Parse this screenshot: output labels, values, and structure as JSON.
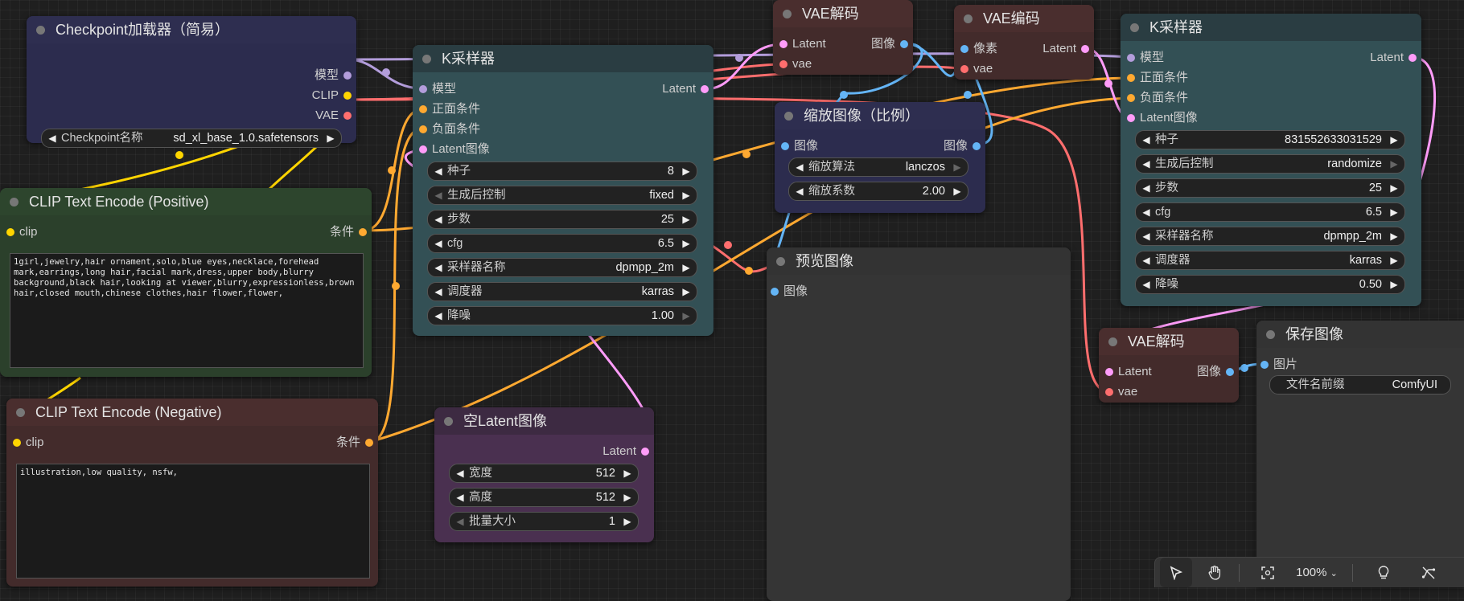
{
  "colors": {
    "model": "#b39ddb",
    "clip": "#ffd500",
    "vae": "#ff6e6e",
    "conditioning": "#ffa931",
    "latent": "#ff9cf9",
    "image": "#64b5f6"
  },
  "checkpoint_loader": {
    "title": "Checkpoint加载器（简易）",
    "outputs": [
      "模型",
      "CLIP",
      "VAE"
    ],
    "widget_label": "Checkpoint名称",
    "widget_value": "sd_xl_base_1.0.safetensors"
  },
  "clip_positive": {
    "title": "CLIP Text Encode (Positive)",
    "input": "clip",
    "output": "条件",
    "text": "1girl,jewelry,hair ornament,solo,blue eyes,necklace,forehead mark,earrings,long hair,facial mark,dress,upper body,blurry background,black hair,looking at viewer,blurry,expressionless,brown hair,closed mouth,chinese clothes,hair flower,flower,"
  },
  "clip_negative": {
    "title": "CLIP Text Encode (Negative)",
    "input": "clip",
    "output": "条件",
    "text": "illustration,low quality, nsfw,"
  },
  "ksampler1": {
    "title": "K采样器",
    "inputs": [
      "模型",
      "正面条件",
      "负面条件",
      "Latent图像"
    ],
    "output": "Latent",
    "widgets": [
      {
        "label": "种子",
        "value": "8"
      },
      {
        "label": "生成后控制",
        "value": "fixed"
      },
      {
        "label": "步数",
        "value": "25"
      },
      {
        "label": "cfg",
        "value": "6.5"
      },
      {
        "label": "采样器名称",
        "value": "dpmpp_2m"
      },
      {
        "label": "调度器",
        "value": "karras"
      },
      {
        "label": "降噪",
        "value": "1.00"
      }
    ]
  },
  "empty_latent": {
    "title": "空Latent图像",
    "output": "Latent",
    "widgets": [
      {
        "label": "宽度",
        "value": "512"
      },
      {
        "label": "高度",
        "value": "512"
      },
      {
        "label": "批量大小",
        "value": "1"
      }
    ]
  },
  "vae_decode1": {
    "title": "VAE解码",
    "inputs": [
      "Latent",
      "vae"
    ],
    "output": "图像"
  },
  "vae_encode": {
    "title": "VAE编码",
    "inputs": [
      "像素",
      "vae"
    ],
    "output": "Latent"
  },
  "upscale": {
    "title": "缩放图像（比例）",
    "input": "图像",
    "output": "图像",
    "widgets": [
      {
        "label": "缩放算法",
        "value": "lanczos"
      },
      {
        "label": "缩放系数",
        "value": "2.00"
      }
    ]
  },
  "preview": {
    "title": "预览图像",
    "input": "图像"
  },
  "ksampler2": {
    "title": "K采样器",
    "inputs": [
      "模型",
      "正面条件",
      "负面条件",
      "Latent图像"
    ],
    "output": "Latent",
    "widgets": [
      {
        "label": "种子",
        "value": "831552633031529"
      },
      {
        "label": "生成后控制",
        "value": "randomize"
      },
      {
        "label": "步数",
        "value": "25"
      },
      {
        "label": "cfg",
        "value": "6.5"
      },
      {
        "label": "采样器名称",
        "value": "dpmpp_2m"
      },
      {
        "label": "调度器",
        "value": "karras"
      },
      {
        "label": "降噪",
        "value": "0.50"
      }
    ]
  },
  "vae_decode2": {
    "title": "VAE解码",
    "inputs": [
      "Latent",
      "vae"
    ],
    "output": "图像"
  },
  "save_image": {
    "title": "保存图像",
    "input": "图片",
    "widget_label": "文件名前缀",
    "widget_value": "ComfyUI"
  },
  "toolbar": {
    "zoom": "100%",
    "icons": [
      "pointer-icon",
      "hand-icon",
      "fit-view-icon",
      "zoom-dropdown",
      "bulb-icon",
      "hide-links-icon"
    ]
  }
}
